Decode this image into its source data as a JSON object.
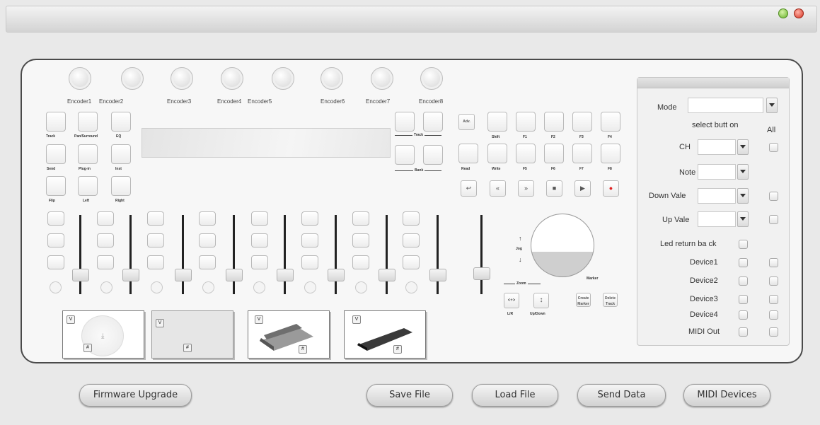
{
  "encoders": [
    "Encoder1",
    "Encoder2",
    "Encoder3",
    "Encoder4",
    "Encoder5",
    "Encoder6",
    "Encoder7",
    "Encoder8"
  ],
  "left_buttons": [
    "Track",
    "Pan/Surround",
    "EQ",
    "Send",
    "Plug-in",
    "Inst",
    "Flip",
    "Left",
    "Right"
  ],
  "track_label": "Track",
  "bank_label": "Bank",
  "fn_row1": [
    "Adv.",
    "Shift",
    "F1",
    "F2",
    "F3",
    "F4"
  ],
  "fn_row2": [
    "Read",
    "Write",
    "F5",
    "F6",
    "F7",
    "F8"
  ],
  "transport": [
    "↩",
    "«",
    "»",
    "■",
    "▶",
    "●"
  ],
  "jog": {
    "jog_label": "Jog",
    "zoom_label": "Zoom",
    "marker_label": "Marker",
    "lr_label": "L/R",
    "updown_label": "Up/Down",
    "create_marker": "Create Marker",
    "delete_track": "Delete Track",
    "lr_glyph": "<+>",
    "ud_glyph": "↕"
  },
  "settings": {
    "mode_label": "Mode",
    "select_label": "select butt on",
    "all_label": "All",
    "ch_label": "CH",
    "note_label": "Note",
    "down_label": "Down Vale",
    "up_label": "Up Vale",
    "led_label": "Led return ba ck",
    "devices": [
      "Device1",
      "Device2",
      "Device3",
      "Device4",
      "MIDI Out"
    ]
  },
  "pedal_marks": [
    "V",
    "#"
  ],
  "bottom_buttons": {
    "firmware": "Firmware Upgrade",
    "save": "Save File",
    "load": "Load File",
    "send": "Send Data",
    "midi": "MIDI Devices"
  },
  "colors": {
    "minimize": "#66b22a",
    "close": "#d63422",
    "record": "#e02020"
  }
}
